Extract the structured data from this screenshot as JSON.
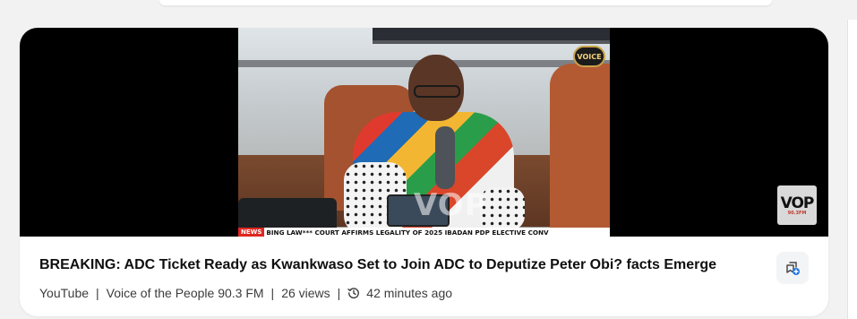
{
  "video": {
    "ticker_label": "NEWS",
    "ticker_text": "BING LAW*** COURT AFFIRMS LEGALITY OF 2025 IBADAN PDP ELECTIVE CONV",
    "watermark": "VOP 90.3FM",
    "channel_bug": "VOICE",
    "corner_logo_main": "VOP",
    "corner_logo_sub": "90.3FM"
  },
  "card": {
    "title": "BREAKING: ADC Ticket Ready as Kwankwaso Set to Join ADC to Deputize Peter Obi? facts Emerge",
    "source": "YouTube",
    "channel": "Voice of the People 90.3 FM",
    "views": "26 views",
    "time_ago": "42 minutes ago",
    "separator": "|"
  },
  "icons": {
    "history": "history-icon",
    "save": "save-to-collection-icon"
  },
  "colors": {
    "ticker_red": "#e0261f",
    "save_icon_blue": "#1a73e8",
    "card_background": "#ffffff",
    "page_background": "#f2f2f2"
  }
}
